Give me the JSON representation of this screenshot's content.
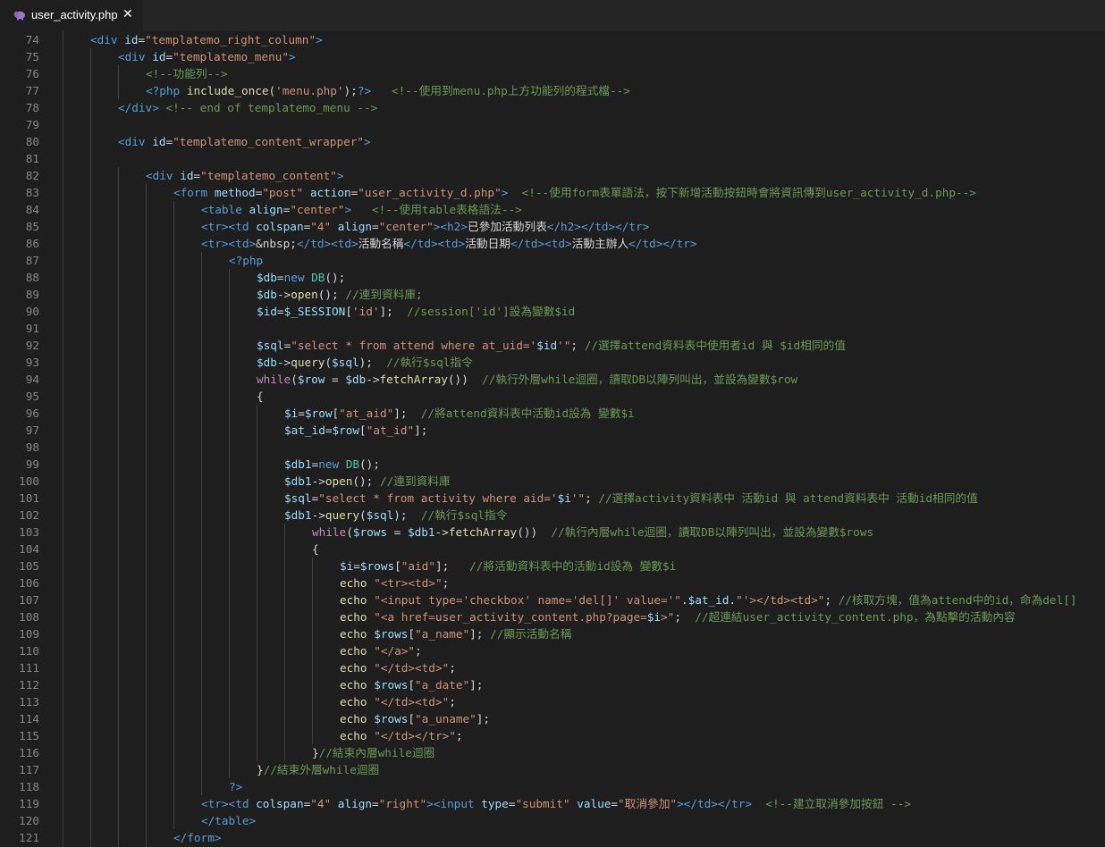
{
  "tab": {
    "filename": "user_activity.php",
    "icon": "php-elephant-icon",
    "close_glyph": "✕"
  },
  "colors": {
    "tag": "#569cd6",
    "attr": "#9cdcfe",
    "string": "#ce9178",
    "comment": "#6a9955",
    "keyword": "#c586c0",
    "function": "#dcdcaa",
    "text": "#d4d4d4",
    "line_number": "#858585"
  },
  "lines": [
    {
      "n": "74",
      "indent": 1,
      "tokens": [
        [
          "t",
          "<div "
        ],
        [
          "a",
          "id"
        ],
        [
          "o",
          "="
        ],
        [
          "s",
          "\"templatemo_right_column\""
        ],
        [
          "t",
          ">"
        ]
      ]
    },
    {
      "n": "75",
      "indent": 2,
      "tokens": [
        [
          "t",
          "<div "
        ],
        [
          "a",
          "id"
        ],
        [
          "o",
          "="
        ],
        [
          "s",
          "\"templatemo_menu\""
        ],
        [
          "t",
          ">"
        ]
      ]
    },
    {
      "n": "76",
      "indent": 3,
      "tokens": [
        [
          "c",
          "<!--功能列-->"
        ]
      ]
    },
    {
      "n": "77",
      "indent": 3,
      "tokens": [
        [
          "pt",
          "<?php "
        ],
        [
          "f",
          "include_once"
        ],
        [
          "o",
          "("
        ],
        [
          "s",
          "'menu.php'"
        ],
        [
          "o",
          ");"
        ],
        [
          "pt",
          "?>"
        ],
        [
          "o",
          "   "
        ],
        [
          "c",
          "<!--使用到menu.php上方功能列的程式檔-->"
        ]
      ]
    },
    {
      "n": "78",
      "indent": 2,
      "tokens": [
        [
          "t",
          "</div>"
        ],
        [
          "o",
          " "
        ],
        [
          "c",
          "<!-- end of templatemo_menu -->"
        ]
      ]
    },
    {
      "n": "79",
      "indent": 0,
      "tokens": []
    },
    {
      "n": "80",
      "indent": 2,
      "tokens": [
        [
          "t",
          "<div "
        ],
        [
          "a",
          "id"
        ],
        [
          "o",
          "="
        ],
        [
          "s",
          "\"templatemo_content_wrapper\""
        ],
        [
          "t",
          ">"
        ]
      ]
    },
    {
      "n": "81",
      "indent": 0,
      "tokens": []
    },
    {
      "n": "82",
      "indent": 3,
      "tokens": [
        [
          "t",
          "<div "
        ],
        [
          "a",
          "id"
        ],
        [
          "o",
          "="
        ],
        [
          "s",
          "\"templatemo_content\""
        ],
        [
          "t",
          ">"
        ]
      ]
    },
    {
      "n": "83",
      "indent": 4,
      "tokens": [
        [
          "t",
          "<form "
        ],
        [
          "a",
          "method"
        ],
        [
          "o",
          "="
        ],
        [
          "s",
          "\"post\""
        ],
        [
          "o",
          " "
        ],
        [
          "a",
          "action"
        ],
        [
          "o",
          "="
        ],
        [
          "s",
          "\"user_activity_d.php\""
        ],
        [
          "t",
          ">"
        ],
        [
          "o",
          "  "
        ],
        [
          "c",
          "<!--使用form表單語法，按下新增活動按鈕時會將資訊傳到user_activity_d.php-->"
        ]
      ]
    },
    {
      "n": "84",
      "indent": 5,
      "tokens": [
        [
          "t",
          "<table "
        ],
        [
          "a",
          "align"
        ],
        [
          "o",
          "="
        ],
        [
          "s",
          "\"center\""
        ],
        [
          "t",
          ">"
        ],
        [
          "o",
          "   "
        ],
        [
          "c",
          "<!--使用table表格語法-->"
        ]
      ]
    },
    {
      "n": "85",
      "indent": 5,
      "tokens": [
        [
          "t",
          "<tr><td "
        ],
        [
          "a",
          "colspan"
        ],
        [
          "o",
          "="
        ],
        [
          "s",
          "\"4\""
        ],
        [
          "o",
          " "
        ],
        [
          "a",
          "align"
        ],
        [
          "o",
          "="
        ],
        [
          "s",
          "\"center\""
        ],
        [
          "t",
          "><h2>"
        ],
        [
          "w",
          "已參加活動列表"
        ],
        [
          "t",
          "</h2></td></tr>"
        ]
      ]
    },
    {
      "n": "86",
      "indent": 5,
      "tokens": [
        [
          "t",
          "<tr><td>"
        ],
        [
          "w",
          "&nbsp;"
        ],
        [
          "t",
          "</td><td>"
        ],
        [
          "w",
          "活動名稱"
        ],
        [
          "t",
          "</td><td>"
        ],
        [
          "w",
          "活動日期"
        ],
        [
          "t",
          "</td><td>"
        ],
        [
          "w",
          "活動主辦人"
        ],
        [
          "t",
          "</td></tr>"
        ]
      ]
    },
    {
      "n": "87",
      "indent": 6,
      "tokens": [
        [
          "pt",
          "<?php"
        ]
      ]
    },
    {
      "n": "88",
      "indent": 7,
      "tokens": [
        [
          "v",
          "$db"
        ],
        [
          "o",
          "="
        ],
        [
          "pt",
          "new "
        ],
        [
          "cl",
          "DB"
        ],
        [
          "o",
          "();"
        ]
      ]
    },
    {
      "n": "89",
      "indent": 7,
      "tokens": [
        [
          "v",
          "$db"
        ],
        [
          "o",
          "->"
        ],
        [
          "f",
          "open"
        ],
        [
          "o",
          "(); "
        ],
        [
          "c",
          "//連到資料庫;"
        ]
      ]
    },
    {
      "n": "90",
      "indent": 7,
      "tokens": [
        [
          "v",
          "$id"
        ],
        [
          "o",
          "="
        ],
        [
          "v",
          "$_SESSION"
        ],
        [
          "o",
          "["
        ],
        [
          "s",
          "'id'"
        ],
        [
          "o",
          "];  "
        ],
        [
          "c",
          "//session['id']設為變數$id"
        ]
      ]
    },
    {
      "n": "91",
      "indent": 0,
      "tokens": []
    },
    {
      "n": "92",
      "indent": 7,
      "tokens": [
        [
          "v",
          "$sql"
        ],
        [
          "o",
          "="
        ],
        [
          "s",
          "\"select * from attend where at_uid='"
        ],
        [
          "v",
          "$id"
        ],
        [
          "s",
          "'\""
        ],
        [
          "o",
          "; "
        ],
        [
          "c",
          "//選擇attend資料表中使用者id 與 $id相同的值"
        ]
      ]
    },
    {
      "n": "93",
      "indent": 7,
      "tokens": [
        [
          "v",
          "$db"
        ],
        [
          "o",
          "->"
        ],
        [
          "f",
          "query"
        ],
        [
          "o",
          "("
        ],
        [
          "v",
          "$sql"
        ],
        [
          "o",
          ");  "
        ],
        [
          "c",
          "//執行$sql指令"
        ]
      ]
    },
    {
      "n": "94",
      "indent": 7,
      "tokens": [
        [
          "k",
          "while"
        ],
        [
          "o",
          "("
        ],
        [
          "v",
          "$row"
        ],
        [
          "o",
          " = "
        ],
        [
          "v",
          "$db"
        ],
        [
          "o",
          "->"
        ],
        [
          "f",
          "fetchArray"
        ],
        [
          "o",
          "())  "
        ],
        [
          "c",
          "//執行外層while迴圈，讀取DB以陣列叫出，並設為變數$row"
        ]
      ]
    },
    {
      "n": "95",
      "indent": 7,
      "tokens": [
        [
          "o",
          "{"
        ]
      ]
    },
    {
      "n": "96",
      "indent": 8,
      "tokens": [
        [
          "v",
          "$i"
        ],
        [
          "o",
          "="
        ],
        [
          "v",
          "$row"
        ],
        [
          "o",
          "["
        ],
        [
          "s",
          "\"at_aid\""
        ],
        [
          "o",
          "];  "
        ],
        [
          "c",
          "//將attend資料表中活動id設為 變數$i"
        ]
      ]
    },
    {
      "n": "97",
      "indent": 8,
      "tokens": [
        [
          "v",
          "$at_id"
        ],
        [
          "o",
          "="
        ],
        [
          "v",
          "$row"
        ],
        [
          "o",
          "["
        ],
        [
          "s",
          "\"at_id\""
        ],
        [
          "o",
          "];"
        ]
      ]
    },
    {
      "n": "98",
      "indent": 0,
      "tokens": []
    },
    {
      "n": "99",
      "indent": 8,
      "tokens": [
        [
          "v",
          "$db1"
        ],
        [
          "o",
          "="
        ],
        [
          "pt",
          "new "
        ],
        [
          "cl",
          "DB"
        ],
        [
          "o",
          "();"
        ]
      ]
    },
    {
      "n": "100",
      "indent": 8,
      "tokens": [
        [
          "v",
          "$db1"
        ],
        [
          "o",
          "->"
        ],
        [
          "f",
          "open"
        ],
        [
          "o",
          "(); "
        ],
        [
          "c",
          "//連到資料庫"
        ]
      ]
    },
    {
      "n": "101",
      "indent": 8,
      "tokens": [
        [
          "v",
          "$sql"
        ],
        [
          "o",
          "="
        ],
        [
          "s",
          "\"select * from activity where aid='"
        ],
        [
          "v",
          "$i"
        ],
        [
          "s",
          "'\""
        ],
        [
          "o",
          "; "
        ],
        [
          "c",
          "//選擇activity資料表中 活動id 與 attend資料表中 活動id相同的值"
        ]
      ]
    },
    {
      "n": "102",
      "indent": 8,
      "tokens": [
        [
          "v",
          "$db1"
        ],
        [
          "o",
          "->"
        ],
        [
          "f",
          "query"
        ],
        [
          "o",
          "("
        ],
        [
          "v",
          "$sql"
        ],
        [
          "o",
          ");  "
        ],
        [
          "c",
          "//執行$sql指令"
        ]
      ]
    },
    {
      "n": "103",
      "indent": 9,
      "tokens": [
        [
          "k",
          "while"
        ],
        [
          "o",
          "("
        ],
        [
          "v",
          "$rows"
        ],
        [
          "o",
          " = "
        ],
        [
          "v",
          "$db1"
        ],
        [
          "o",
          "->"
        ],
        [
          "f",
          "fetchArray"
        ],
        [
          "o",
          "())  "
        ],
        [
          "c",
          "//執行內層while迴圈，讀取DB以陣列叫出，並設為變數$rows"
        ]
      ]
    },
    {
      "n": "104",
      "indent": 9,
      "tokens": [
        [
          "o",
          "{"
        ]
      ]
    },
    {
      "n": "105",
      "indent": 10,
      "tokens": [
        [
          "v",
          "$i"
        ],
        [
          "o",
          "="
        ],
        [
          "v",
          "$rows"
        ],
        [
          "o",
          "["
        ],
        [
          "s",
          "\"aid\""
        ],
        [
          "o",
          "];   "
        ],
        [
          "c",
          "//將活動資料表中的活動id設為 變數$i"
        ]
      ]
    },
    {
      "n": "106",
      "indent": 10,
      "tokens": [
        [
          "f",
          "echo "
        ],
        [
          "s",
          "\"<tr><td>\""
        ],
        [
          "o",
          ";"
        ]
      ]
    },
    {
      "n": "107",
      "indent": 10,
      "tokens": [
        [
          "f",
          "echo "
        ],
        [
          "s",
          "\"<input type='checkbox' name='del[]' value='\""
        ],
        [
          "o",
          "."
        ],
        [
          "v",
          "$at_id"
        ],
        [
          "o",
          "."
        ],
        [
          "s",
          "\"'></td><td>\""
        ],
        [
          "o",
          "; "
        ],
        [
          "c",
          "//核取方塊，值為attend中的id，命為del[]"
        ]
      ]
    },
    {
      "n": "108",
      "indent": 10,
      "tokens": [
        [
          "f",
          "echo "
        ],
        [
          "s",
          "\"<a href=user_activity_content.php?page="
        ],
        [
          "v",
          "$i"
        ],
        [
          "s",
          ">\""
        ],
        [
          "o",
          ";  "
        ],
        [
          "c",
          "//超連結user_activity_content.php，為點擊的活動內容"
        ]
      ]
    },
    {
      "n": "109",
      "indent": 10,
      "tokens": [
        [
          "f",
          "echo "
        ],
        [
          "v",
          "$rows"
        ],
        [
          "o",
          "["
        ],
        [
          "s",
          "\"a_name\""
        ],
        [
          "o",
          "]; "
        ],
        [
          "c",
          "//顯示活動名稱"
        ]
      ]
    },
    {
      "n": "110",
      "indent": 10,
      "tokens": [
        [
          "f",
          "echo "
        ],
        [
          "s",
          "\"</a>\""
        ],
        [
          "o",
          ";"
        ]
      ]
    },
    {
      "n": "111",
      "indent": 10,
      "tokens": [
        [
          "f",
          "echo "
        ],
        [
          "s",
          "\"</td><td>\""
        ],
        [
          "o",
          ";"
        ]
      ]
    },
    {
      "n": "112",
      "indent": 10,
      "tokens": [
        [
          "f",
          "echo "
        ],
        [
          "v",
          "$rows"
        ],
        [
          "o",
          "["
        ],
        [
          "s",
          "\"a_date\""
        ],
        [
          "o",
          "];"
        ]
      ]
    },
    {
      "n": "113",
      "indent": 10,
      "tokens": [
        [
          "f",
          "echo "
        ],
        [
          "s",
          "\"</td><td>\""
        ],
        [
          "o",
          ";"
        ]
      ]
    },
    {
      "n": "114",
      "indent": 10,
      "tokens": [
        [
          "f",
          "echo "
        ],
        [
          "v",
          "$rows"
        ],
        [
          "o",
          "["
        ],
        [
          "s",
          "\"a_uname\""
        ],
        [
          "o",
          "];"
        ]
      ]
    },
    {
      "n": "115",
      "indent": 10,
      "tokens": [
        [
          "f",
          "echo "
        ],
        [
          "s",
          "\"</td></tr>\""
        ],
        [
          "o",
          ";"
        ]
      ]
    },
    {
      "n": "116",
      "indent": 9,
      "tokens": [
        [
          "o",
          "}"
        ],
        [
          "c",
          "//結束內層while迴圈"
        ]
      ]
    },
    {
      "n": "117",
      "indent": 7,
      "tokens": [
        [
          "o",
          "}"
        ],
        [
          "c",
          "//結束外層while迴圈"
        ]
      ]
    },
    {
      "n": "118",
      "indent": 6,
      "tokens": [
        [
          "pt",
          "?>"
        ]
      ]
    },
    {
      "n": "119",
      "indent": 5,
      "tokens": [
        [
          "t",
          "<tr><td "
        ],
        [
          "a",
          "colspan"
        ],
        [
          "o",
          "="
        ],
        [
          "s",
          "\"4\""
        ],
        [
          "o",
          " "
        ],
        [
          "a",
          "align"
        ],
        [
          "o",
          "="
        ],
        [
          "s",
          "\"right\""
        ],
        [
          "t",
          "><input "
        ],
        [
          "a",
          "type"
        ],
        [
          "o",
          "="
        ],
        [
          "s",
          "\"submit\""
        ],
        [
          "o",
          " "
        ],
        [
          "a",
          "value"
        ],
        [
          "o",
          "="
        ],
        [
          "s",
          "\"取消參加\""
        ],
        [
          "t",
          "></td></tr>"
        ],
        [
          "o",
          "  "
        ],
        [
          "c",
          "<!--建立取消參加按鈕 -->"
        ]
      ]
    },
    {
      "n": "120",
      "indent": 5,
      "tokens": [
        [
          "t",
          "</table>"
        ]
      ]
    },
    {
      "n": "121",
      "indent": 4,
      "tokens": [
        [
          "t",
          "</form>"
        ]
      ]
    }
  ]
}
